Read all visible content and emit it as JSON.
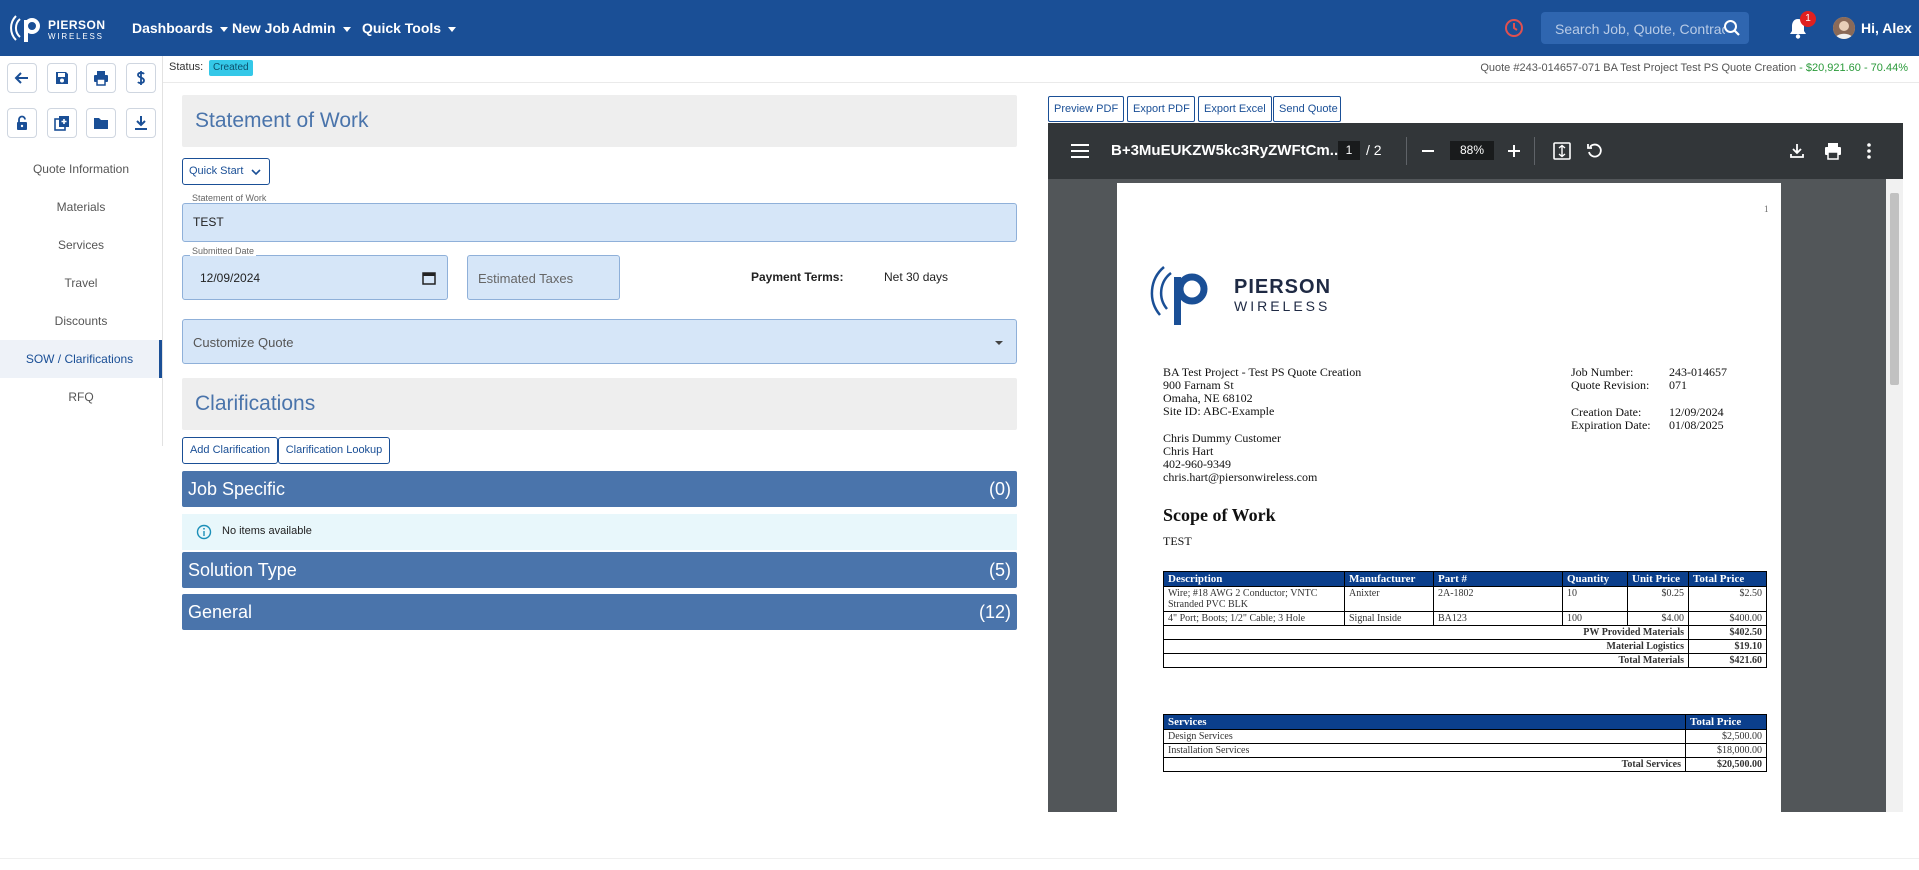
{
  "header": {
    "logo_line1": "PIERSON",
    "logo_line2": "WIRELESS",
    "nav": [
      {
        "label": "Dashboards",
        "dropdown": true
      },
      {
        "label": "New Job",
        "dropdown": false
      },
      {
        "label": "Admin",
        "dropdown": true
      },
      {
        "label": "Quick Tools",
        "dropdown": true
      }
    ],
    "search_placeholder": "Search Job, Quote, Contract",
    "notification_count": "1",
    "greeting": "Hi, Alex",
    "colors": {
      "bar": "#1a4f96",
      "clock": "#e05050",
      "badge": "#e02020"
    }
  },
  "toolbar_icons": [
    "back-arrow-icon",
    "save-icon",
    "print-icon",
    "dollar-icon",
    "unlock-icon",
    "add-copy-icon",
    "folder-icon",
    "download-icon"
  ],
  "sidebar": {
    "items": [
      {
        "label": "Quote Information",
        "active": false
      },
      {
        "label": "Materials",
        "active": false
      },
      {
        "label": "Services",
        "active": false
      },
      {
        "label": "Travel",
        "active": false
      },
      {
        "label": "Discounts",
        "active": false
      },
      {
        "label": "SOW / Clarifications",
        "active": true
      },
      {
        "label": "RFQ",
        "active": false
      }
    ]
  },
  "status": {
    "label": "Status:",
    "badge": "Created",
    "quote_info": "Quote #243-014657-071 BA Test Project Test PS Quote Creation",
    "quote_amount": " - $20,921.60 - 70.44%"
  },
  "sow": {
    "title": "Statement of Work",
    "quick_start": "Quick Start",
    "sow_label": "Statement of Work",
    "sow_value": "TEST",
    "date_label": "Submitted Date",
    "date_value": "12/09/2024",
    "taxes_placeholder": "Estimated Taxes",
    "payment_terms_label": "Payment Terms:",
    "payment_terms_value": "Net 30 days",
    "customize_label": "Customize Quote"
  },
  "clarifications": {
    "title": "Clarifications",
    "add_button": "Add Clarification",
    "lookup_button": "Clarification Lookup",
    "groups": [
      {
        "title": "Job Specific",
        "count": "(0)"
      },
      {
        "title": "Solution Type",
        "count": "(5)"
      },
      {
        "title": "General",
        "count": "(12)"
      }
    ],
    "empty_message": "No items available"
  },
  "pdf_actions": [
    "Preview PDF",
    "Export PDF",
    "Export Excel",
    "Send Quote"
  ],
  "pdf_viewer": {
    "filename": "B+3MuEUKZW5kc3RyZWFtCm...",
    "page": "1",
    "total_pages": "/ 2",
    "zoom": "88%"
  },
  "pdf_doc": {
    "page_number": "1",
    "logo_line1": "PIERSON",
    "logo_line2": "WIRELESS",
    "address": [
      "BA Test Project - Test PS Quote Creation",
      "900 Farnam St",
      "Omaha, NE 68102",
      "Site ID: ABC-Example"
    ],
    "contact": [
      "Chris Dummy Customer",
      "Chris Hart",
      "402-960-9349",
      "chris.hart@piersonwireless.com"
    ],
    "meta": [
      {
        "k": "Job Number:",
        "v": "243-014657"
      },
      {
        "k": "Quote Revision:",
        "v": "071"
      },
      {
        "k": "Creation Date:",
        "v": "12/09/2024"
      },
      {
        "k": "Expiration Date:",
        "v": "01/08/2025"
      }
    ],
    "scope_title": "Scope of Work",
    "scope_text": "TEST",
    "materials_headers": [
      "Description",
      "Manufacturer",
      "Part #",
      "Quantity",
      "Unit Price",
      "Total Price"
    ],
    "materials_rows": [
      [
        "Wire; #18 AWG 2 Conductor; VNTC Stranded PVC BLK",
        "Anixter",
        "2A-1802",
        "10",
        "$0.25",
        "$2.50"
      ],
      [
        "4\" Port; Boots; 1/2\" Cable; 3 Hole",
        "Signal Inside",
        "BA123",
        "100",
        "$4.00",
        "$400.00"
      ]
    ],
    "materials_totals": [
      {
        "label": "PW Provided Materials",
        "value": "$402.50"
      },
      {
        "label": "Material Logistics",
        "value": "$19.10"
      },
      {
        "label": "Total Materials",
        "value": "$421.60"
      }
    ],
    "services_headers": [
      "Services",
      "Total Price"
    ],
    "services_rows": [
      [
        "Design Services",
        "$2,500.00"
      ],
      [
        "Installation Services",
        "$18,000.00"
      ]
    ],
    "services_total": {
      "label": "Total Services",
      "value": "$20,500.00"
    }
  }
}
